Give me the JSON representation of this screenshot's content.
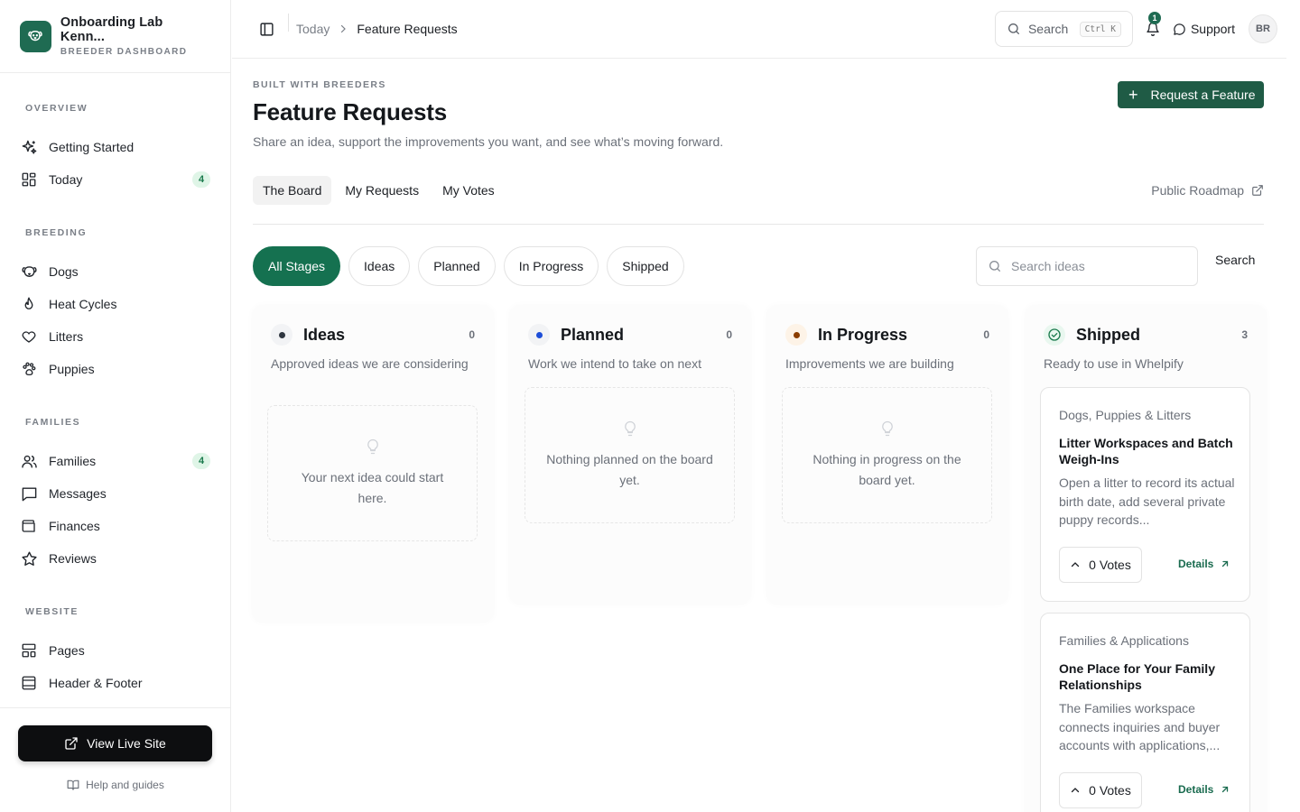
{
  "brand": {
    "title": "Onboarding Lab Kenn...",
    "subtitle": "BREEDER DASHBOARD"
  },
  "sidebar": {
    "sections": [
      {
        "title": "OVERVIEW"
      },
      {
        "title": "BREEDING"
      },
      {
        "title": "FAMILIES"
      },
      {
        "title": "WEBSITE"
      }
    ],
    "items": [
      {
        "label": "Getting Started",
        "icon": "sparkles-icon"
      },
      {
        "label": "Today",
        "icon": "dashboard-grid-icon",
        "badge": "4"
      },
      {
        "label": "Dogs",
        "icon": "dog-face-icon"
      },
      {
        "label": "Heat Cycles",
        "icon": "flame-icon"
      },
      {
        "label": "Litters",
        "icon": "heart-icon"
      },
      {
        "label": "Puppies",
        "icon": "paw-print-icon"
      },
      {
        "label": "Families",
        "icon": "users-icon",
        "badge": "4"
      },
      {
        "label": "Messages",
        "icon": "message-square-icon"
      },
      {
        "label": "Finances",
        "icon": "wallet-icon"
      },
      {
        "label": "Reviews",
        "icon": "star-icon"
      },
      {
        "label": "Pages",
        "icon": "layout-icon"
      },
      {
        "label": "Header & Footer",
        "icon": "panel-icon"
      }
    ],
    "live_site": "View Live Site",
    "help": "Help and guides"
  },
  "topbar": {
    "breadcrumb": [
      "Today",
      "Feature Requests"
    ],
    "search_label": "Search",
    "search_shortcut": "Ctrl K",
    "notification_count": "1",
    "support": "Support",
    "avatar_initials": "BR"
  },
  "page": {
    "eyebrow": "BUILT WITH BREEDERS",
    "title": "Feature Requests",
    "description": "Share an idea, support the improvements you want, and see what’s moving forward.",
    "request_button": "Request a Feature",
    "tabs": [
      "The Board",
      "My Requests",
      "My Votes"
    ],
    "roadmap_link": "Public Roadmap",
    "filters": [
      "All Stages",
      "Ideas",
      "Planned",
      "In Progress",
      "Shipped"
    ],
    "search_placeholder": "Search ideas",
    "search_button": "Search"
  },
  "colors": {
    "accent": "#157150",
    "brand": "#1f6b52",
    "ideas_dot": "#2f3640",
    "planned_dot": "#1d4ed8",
    "progress_dot": "#8a3d00",
    "shipped_check": "#1a7a4c"
  },
  "columns": [
    {
      "title": "Ideas",
      "count": "0",
      "description": "Approved ideas we are considering",
      "empty": "Your next idea could start here."
    },
    {
      "title": "Planned",
      "count": "0",
      "description": "Work we intend to take on next",
      "empty": "Nothing planned on the board yet."
    },
    {
      "title": "In Progress",
      "count": "0",
      "description": "Improvements we are building",
      "empty": "Nothing in progress on the board yet."
    },
    {
      "title": "Shipped",
      "count": "3",
      "description": "Ready to use in Whelpify",
      "cards": [
        {
          "category": "Dogs, Puppies & Litters",
          "title": "Litter Workspaces and Batch Weigh-Ins",
          "description": "Open a litter to record its actual birth date, add several private puppy records...",
          "votes": "0 Votes",
          "details": "Details"
        },
        {
          "category": "Families & Applications",
          "title": "One Place for Your Family Relationships",
          "description": "The Families workspace connects inquiries and buyer accounts with applications,...",
          "votes": "0 Votes",
          "details": "Details"
        }
      ]
    }
  ]
}
